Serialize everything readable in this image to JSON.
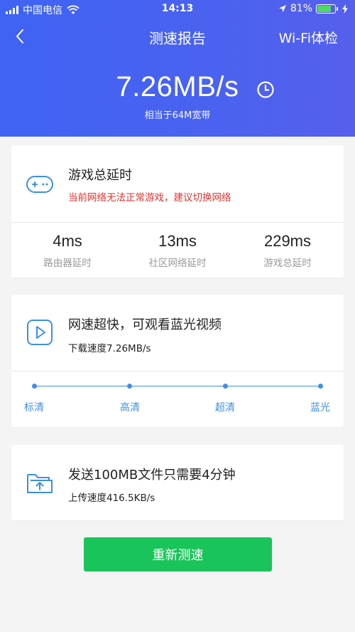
{
  "status_bar": {
    "carrier": "中国电信",
    "time": "14:13",
    "battery_text": "81%",
    "battery_level": 0.81
  },
  "nav": {
    "title": "测速报告",
    "right_action": "Wi-Fi体检"
  },
  "speed": {
    "value": "7.26MB/s",
    "equivalent": "相当于64M宽带"
  },
  "game_card": {
    "title": "游戏总延时",
    "warning": "当前网络无法正常游戏，建议切换网络",
    "stats": [
      {
        "value": "4ms",
        "label": "路由器延时"
      },
      {
        "value": "13ms",
        "label": "社区网络延时"
      },
      {
        "value": "229ms",
        "label": "游戏总延时"
      }
    ]
  },
  "video_card": {
    "title": "网速超快，可观看蓝光视频",
    "desc": "下载速度7.26MB/s",
    "levels": [
      "标清",
      "高清",
      "超清",
      "蓝光"
    ]
  },
  "upload_card": {
    "title": "发送100MB文件只需要4分钟",
    "desc": "上传速度416.5KB/s"
  },
  "retest_label": "重新测速",
  "colors": {
    "header_blue": "#4a62f0",
    "accent_blue": "#3d8fe2",
    "warning_red": "#e0312d",
    "button_green": "#19c45a"
  }
}
